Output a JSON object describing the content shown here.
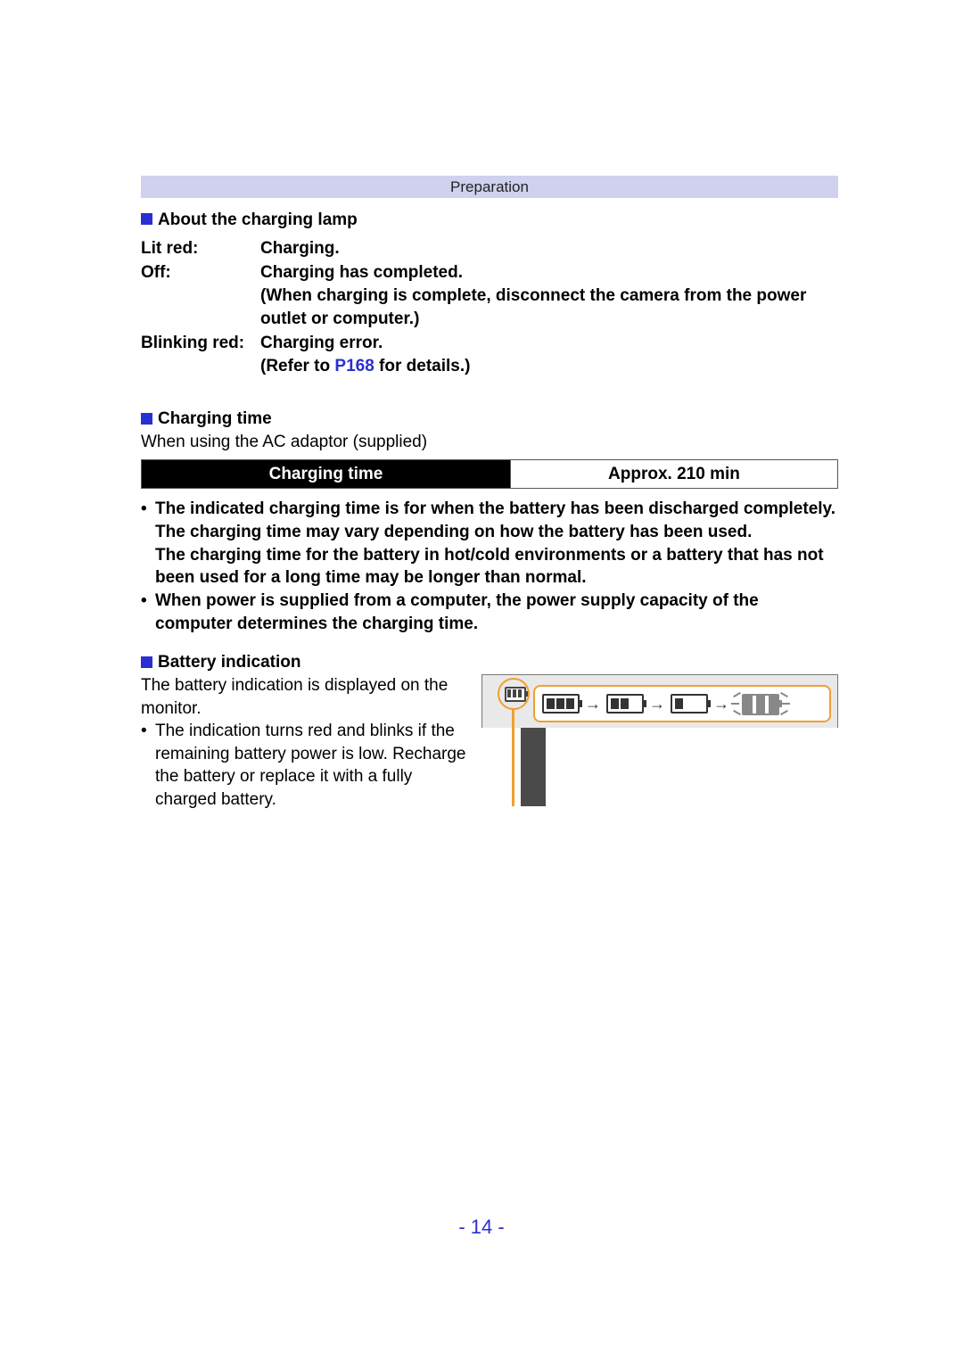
{
  "header": {
    "category": "Preparation"
  },
  "sections": {
    "lamp": {
      "title": "About the charging lamp",
      "rows": [
        {
          "label": "Lit red:",
          "desc": "Charging."
        },
        {
          "label": "Off:",
          "desc": "Charging has completed.\n(When charging is complete, disconnect the camera from the power outlet or computer.)"
        }
      ],
      "blink_label": "Blinking red:",
      "blink_line1": "Charging error.",
      "blink_prefix": "(Refer to ",
      "blink_link": "P168",
      "blink_suffix": " for details.)"
    },
    "charging_time": {
      "title": "Charging time",
      "subtitle": "When using the AC adaptor (supplied)",
      "table_header": "Charging time",
      "table_value": "Approx. 210 min"
    },
    "notes": {
      "n1a": "The indicated charging time is for when the battery has been discharged completely.",
      "n1b": "The charging time may vary depending on how the battery has been used.",
      "n1c": "The charging time for the battery in hot/cold environments or a battery that has not been used for a long time may be longer than normal.",
      "n2": "When power is supplied from a computer, the power supply capacity of the computer determines the charging time."
    },
    "battery": {
      "title": "Battery indication",
      "line": "The battery indication is displayed on the monitor.",
      "bullet": "The indication turns red and blinks if the remaining battery power is low. Recharge the battery or replace it with a fully charged battery."
    }
  },
  "footer": {
    "page": "- 14 -"
  }
}
